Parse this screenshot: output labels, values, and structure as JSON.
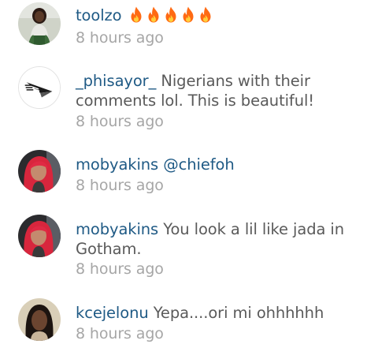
{
  "comments": [
    {
      "username": "toolzo",
      "text": "",
      "emoji": [
        "fire-icon",
        "fire-icon",
        "fire-icon",
        "fire-icon",
        "fire-icon"
      ],
      "time": "8 hours ago",
      "avatar": "woman-green-dress-avatar"
    },
    {
      "username": "_phisayor_",
      "text": "Nigerians with their comments lol. This is beautiful!",
      "time": "8 hours ago",
      "avatar": "paper-plane-logo-avatar"
    },
    {
      "username": "mobyakins",
      "text": "",
      "mention": "@chiefoh",
      "time": "8 hours ago",
      "avatar": "red-hair-woman-avatar"
    },
    {
      "username": "mobyakins",
      "text": "You look a lil like jada in Gotham.",
      "time": "8 hours ago",
      "avatar": "red-hair-woman-avatar"
    },
    {
      "username": "kcejelonu",
      "text": "Yepa....ori mi ohhhhhh",
      "time": "8 hours ago",
      "avatar": "woman-portrait-avatar"
    }
  ],
  "colors": {
    "username": "#1f5a85",
    "text": "#5a5a5a",
    "timestamp": "#a6a6a6",
    "fire": "#ff6a13"
  }
}
